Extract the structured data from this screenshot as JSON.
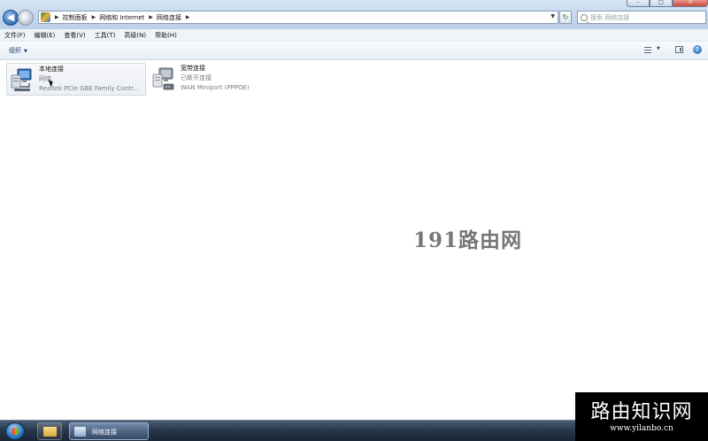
{
  "window": {
    "controls": [
      "minimize",
      "maximize",
      "close"
    ]
  },
  "address_bar": {
    "breadcrumbs": [
      "控制面板",
      "网络和 Internet",
      "网络连接"
    ]
  },
  "search": {
    "placeholder": "搜索 网络连接"
  },
  "menu": {
    "items": [
      "文件(F)",
      "编辑(E)",
      "查看(V)",
      "工具(T)",
      "高级(N)",
      "帮助(H)"
    ]
  },
  "toolbar": {
    "organize_label": "组织"
  },
  "connections": [
    {
      "name": "本地连接",
      "status": "网络",
      "device": "Realtek PCIe GBE Family Contr...",
      "icon": "wired-network-icon",
      "selected": true
    },
    {
      "name": "宽带连接",
      "status": "已断开连接",
      "device": "WAN Miniport (PPPOE)",
      "icon": "broadband-connection-icon",
      "selected": false
    }
  ],
  "watermarks": {
    "center": "191路由网",
    "corner_title": "路由知识网",
    "corner_url": "www.yilanbo.cn"
  },
  "taskbar": {
    "task_label": "网络连接"
  },
  "colors": {
    "caption": "#c3d6ee",
    "taskbar": "#283649",
    "selection": "#eceff3"
  }
}
